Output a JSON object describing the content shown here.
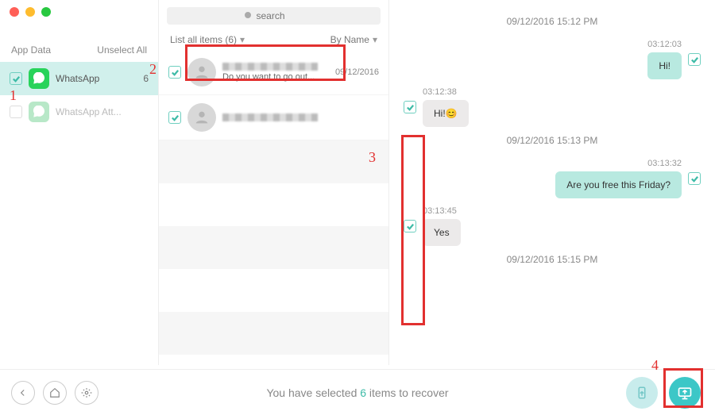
{
  "sidebar": {
    "header_label": "App Data",
    "unselect_label": "Unselect All",
    "items": [
      {
        "label": "WhatsApp",
        "count": "6"
      },
      {
        "label": "WhatsApp Att..."
      }
    ]
  },
  "search": {
    "placeholder": "search"
  },
  "filters": {
    "left": "List all items (6)",
    "right": "By Name"
  },
  "threads": [
    {
      "preview": "Do you want to go out...",
      "date": "09/12/2016"
    }
  ],
  "chat": {
    "sections": [
      {
        "date": "09/12/2016 15:12 PM",
        "messages": [
          {
            "side": "right",
            "time": "03:12:03",
            "text": "Hi!"
          },
          {
            "side": "left",
            "time": "03:12:38",
            "text": "Hi!😊"
          }
        ]
      },
      {
        "date": "09/12/2016 15:13 PM",
        "messages": [
          {
            "side": "right",
            "time": "03:13:32",
            "text": "Are you free this Friday?"
          },
          {
            "side": "left",
            "time": "03:13:45",
            "text": "Yes"
          }
        ]
      },
      {
        "date": "09/12/2016 15:15 PM",
        "messages": []
      }
    ]
  },
  "footer": {
    "prefix": "You have selected ",
    "count": "6",
    "suffix": " items to recover"
  },
  "annotations": [
    "1",
    "2",
    "3",
    "4"
  ]
}
